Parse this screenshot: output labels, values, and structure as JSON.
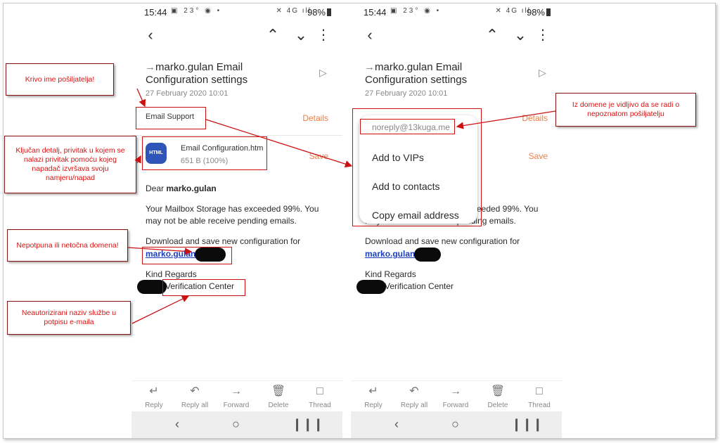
{
  "status": {
    "time": "15:44",
    "icons": "▣ 23° ◉ •",
    "right_icons": "✕ 4G ıll",
    "battery": "98%"
  },
  "email": {
    "subject": "marko.gulan Email Configuration settings",
    "date": "27 February 2020 10:01",
    "sender_name": "Email Support",
    "details": "Details",
    "attachment_icon": "HTML",
    "attachment_name": "Email Configuration.htm",
    "attachment_size": "651 B (100%)",
    "save": "Save",
    "greeting_prefix": "Dear ",
    "greeting_name": "marko.gulan",
    "para1": "Your Mailbox Storage has exceeded 99%. You may not be able receive pending emails.",
    "para2": "Download and save new configuration for",
    "link": "marko.gulan",
    "regards": "Kind Regards",
    "signature": "Verification Center"
  },
  "toolbar": [
    "Reply",
    "Reply all",
    "Forward",
    "Delete",
    "Thread"
  ],
  "menu": {
    "email": "noreply@13kuga.me",
    "items": [
      "Add to VIPs",
      "Add to contacts",
      "Copy email address"
    ]
  },
  "annotations": {
    "wrong_sender": "Krivo ime pošiljatelja!",
    "attachment": "Ključan detalj, privitak u kojem se nalazi privitak pomoću kojeg napadač izvršava svoju namjeru/napad",
    "domain_incomplete": "Nepotpuna ili netočna domena!",
    "unauthorized": "Neautorizirani naziv službe u potpisu e-maila",
    "unknown_sender": "Iz domene je vidljivo da se radi o nepoznatom pošiljatelju"
  },
  "colors": {
    "accent": "#e8804a",
    "annotation": "#cc1010",
    "link": "#1b3fbf"
  }
}
